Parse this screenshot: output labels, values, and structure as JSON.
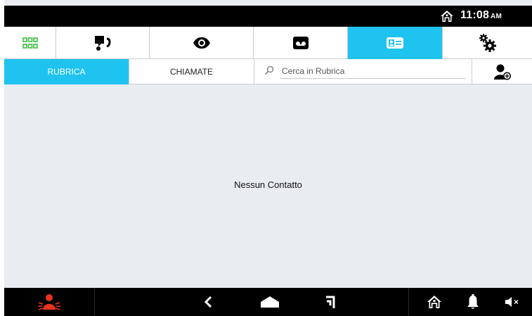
{
  "status_bar": {
    "time": "11:08",
    "ampm": "AM",
    "home_icon": "home-icon"
  },
  "tabs": [
    {
      "id": "apps",
      "icon": "grid-icon",
      "active": false
    },
    {
      "id": "intercom",
      "icon": "intercom-icon",
      "active": false
    },
    {
      "id": "surveillance",
      "icon": "eye-icon",
      "active": false
    },
    {
      "id": "answering-machine",
      "icon": "voicemail-icon",
      "active": false
    },
    {
      "id": "address-book",
      "icon": "contact-card-icon",
      "active": true
    },
    {
      "id": "settings",
      "icon": "gears-icon",
      "active": false
    }
  ],
  "subtabs": {
    "rubrica": "RUBRICA",
    "chiamate": "CHIAMATE"
  },
  "search": {
    "placeholder": "Cerca in Rubrica",
    "value": ""
  },
  "content": {
    "empty_message": "Nessun Contatto"
  },
  "navbar": {
    "icons": [
      "alarm-icon",
      "back-icon",
      "home-nav-icon",
      "recent-icon",
      "home-icon",
      "bell-icon",
      "mute-icon"
    ]
  },
  "colors": {
    "accent": "#1fc3ef",
    "apps_green": "#3bbf3b",
    "alarm_red": "#e8341c",
    "background": "#e9ecf1"
  }
}
